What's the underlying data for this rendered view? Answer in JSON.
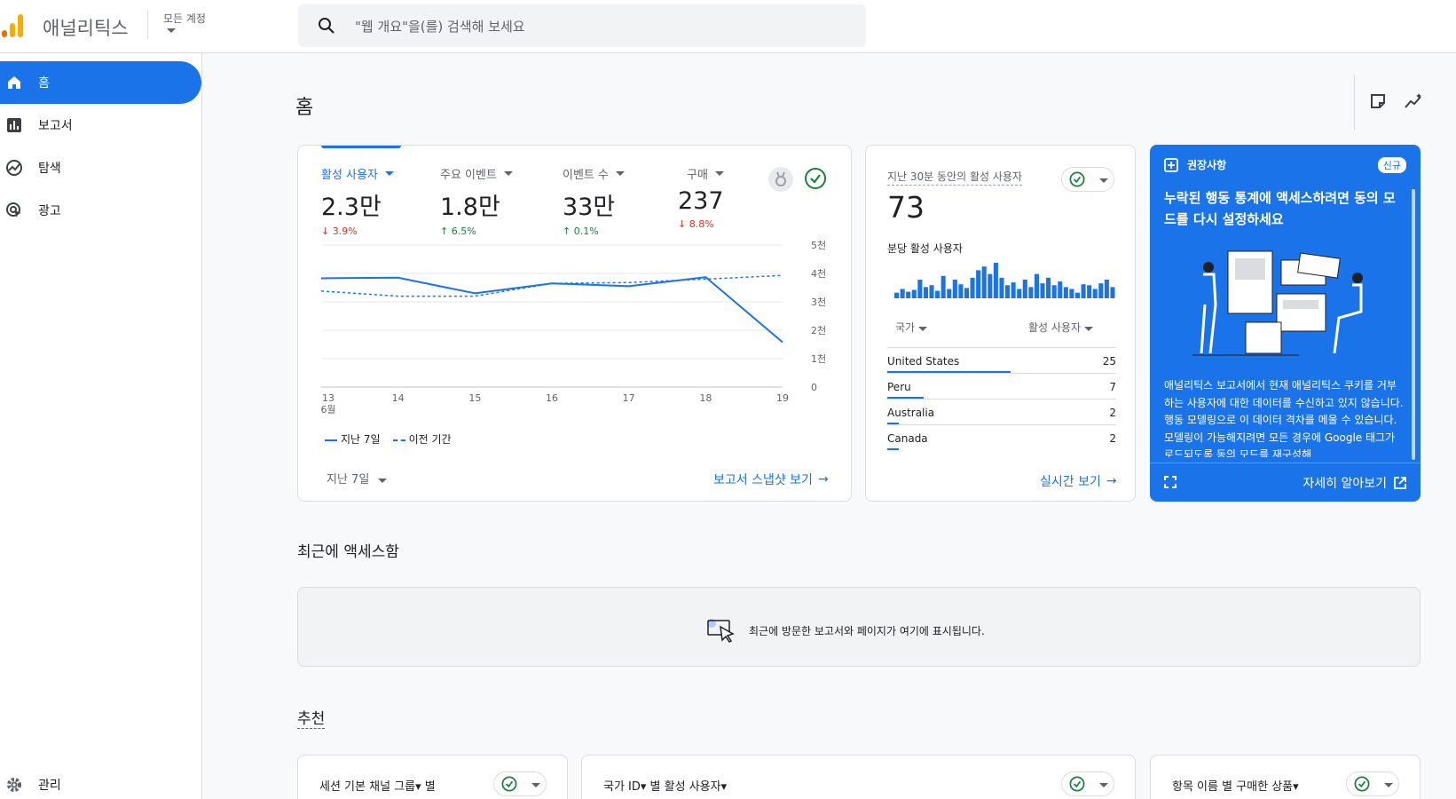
{
  "header": {
    "app_title": "애널리틱스",
    "account_label": "모든 계정",
    "search_placeholder": "\"웹 개요\"을(를) 검색해 보세요"
  },
  "sidebar": {
    "items": [
      {
        "label": "홈",
        "icon": "home-icon",
        "active": true
      },
      {
        "label": "보고서",
        "icon": "bar-chart-icon"
      },
      {
        "label": "탐색",
        "icon": "explore-icon"
      },
      {
        "label": "광고",
        "icon": "ads-icon"
      }
    ],
    "admin_label": "관리"
  },
  "main": {
    "page_title": "홈",
    "overview": {
      "metrics": [
        {
          "label": "활성 사용자",
          "value": "2.3만",
          "change": "3.9%",
          "direction": "down"
        },
        {
          "label": "주요 이벤트",
          "value": "1.8만",
          "change": "6.5%",
          "direction": "up"
        },
        {
          "label": "이벤트 수",
          "value": "33만",
          "change": "0.1%",
          "direction": "up"
        },
        {
          "label": "구매",
          "value": "237",
          "change": "8.8%",
          "direction": "down"
        }
      ],
      "legend_current": "지난 7일",
      "legend_previous": "이전 기간",
      "period_label": "지난 7일",
      "snapshot_link": "보고서 스냅샷 보기"
    },
    "realtime": {
      "title": "지난 30분 동안의 활성 사용자",
      "value": "73",
      "per_minute_label": "분당 활성 사용자",
      "col_country": "국가",
      "col_users": "활성 사용자",
      "rows": [
        {
          "country": "United States",
          "count": "25",
          "share": 0.54
        },
        {
          "country": "Peru",
          "count": "7",
          "share": 0.16
        },
        {
          "country": "Australia",
          "count": "2",
          "share": 0.05
        },
        {
          "country": "Canada",
          "count": "2",
          "share": 0.05
        }
      ],
      "bars": [
        6,
        10,
        7,
        9,
        20,
        12,
        14,
        8,
        24,
        10,
        20,
        15,
        11,
        22,
        30,
        34,
        26,
        38,
        22,
        14,
        17,
        10,
        20,
        12,
        26,
        16,
        22,
        14,
        18,
        12,
        10,
        6,
        15,
        14,
        10,
        16,
        20,
        12
      ],
      "link": "실시간 보기"
    },
    "recommendation": {
      "header": "권장사항",
      "badge": "신규",
      "title": "누락된 행동 통계에 액세스하려면 동의 모드를 다시 설정하세요",
      "body": "애널리틱스 보고서에서 현재 애널리틱스 쿠키를 거부하는 사용자에 대한 데이터를 수신하고 있지 않습니다. 행동 모델링으로 이 데이터 격차를 메울 수 있습니다. 모델링이 가능해지려면 모든 경우에 Google 태그가 로드되도록 동의 모드를 재구성해",
      "more_link": "자세히 알아보기"
    },
    "recent": {
      "title": "최근에 액세스함",
      "message": "최근에 방문한 보고서와 페이지가 여기에 표시됩니다."
    },
    "suggested": {
      "title": "추천",
      "cards": [
        {
          "title": "세션 기본 채널 그룹▾ 별"
        },
        {
          "title": "국가 ID▾ 별 활성 사용자▾"
        },
        {
          "title": "항목 이름 별 구매한 상품▾"
        }
      ]
    }
  },
  "chart_data": {
    "type": "line",
    "x": [
      "13\n6월",
      "14",
      "15",
      "16",
      "17",
      "18",
      "19"
    ],
    "x_tick_labels": [
      "13",
      "14",
      "15",
      "16",
      "17",
      "18",
      "19"
    ],
    "x_sub_label": "6월",
    "y_tick_labels": [
      "0",
      "1천",
      "2천",
      "3천",
      "4천",
      "5천"
    ],
    "ylim": [
      0,
      5000
    ],
    "series": [
      {
        "name": "지난 7일",
        "values": [
          3830,
          3850,
          3300,
          3650,
          3550,
          3870,
          1580
        ],
        "style": "solid"
      },
      {
        "name": "이전 기간",
        "values": [
          3380,
          3200,
          3200,
          3650,
          3680,
          3800,
          3930
        ],
        "style": "dashed"
      }
    ],
    "grid": true,
    "color": "#1a73e8"
  }
}
